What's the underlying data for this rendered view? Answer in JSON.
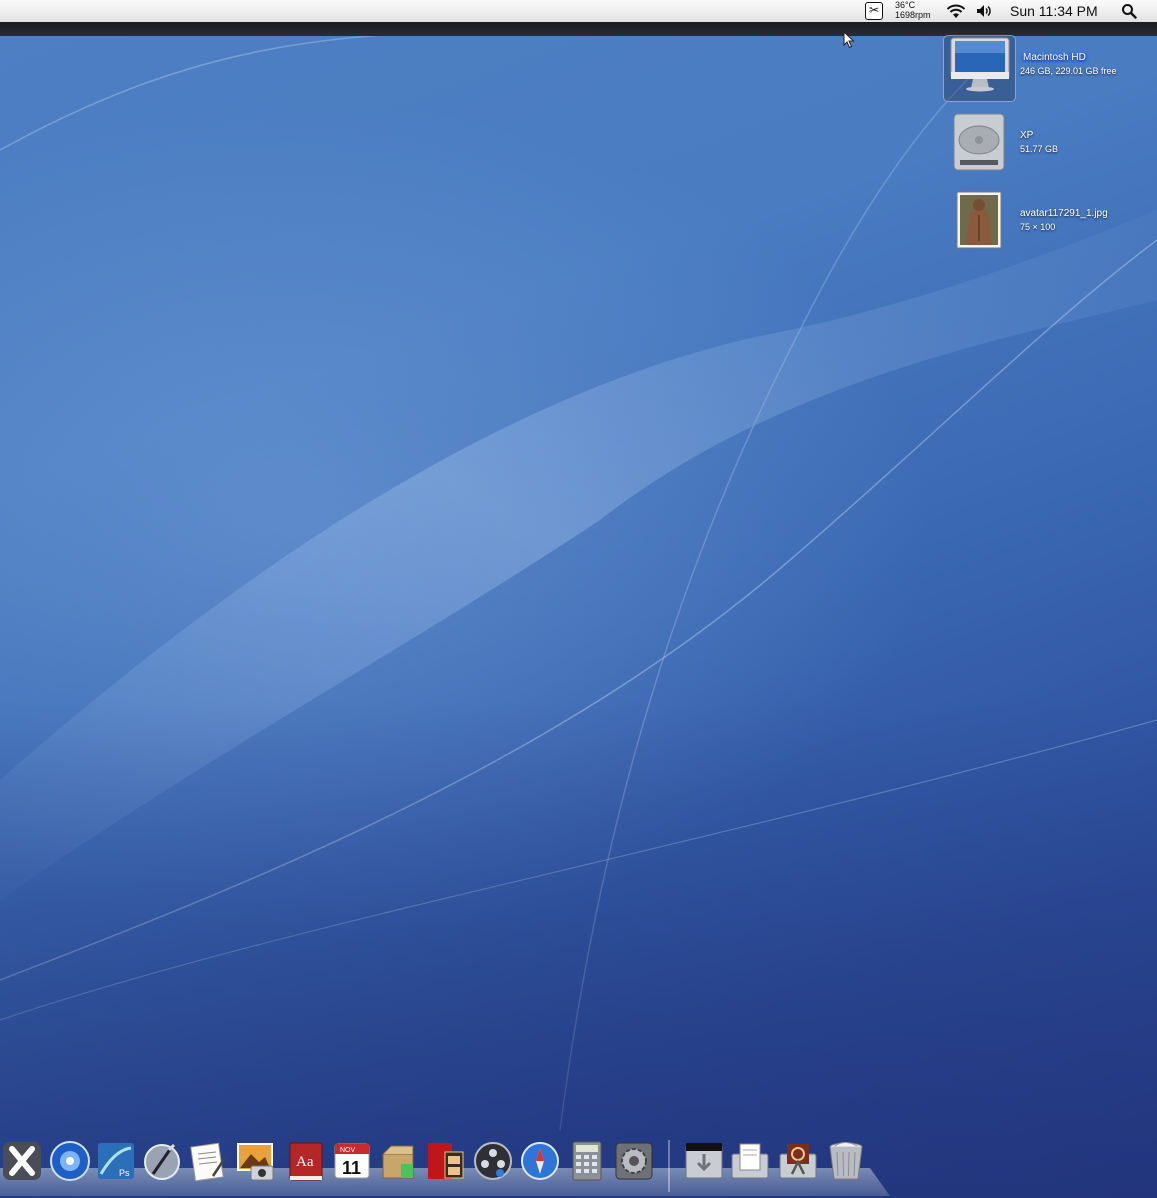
{
  "menubar": {
    "temperature": "36°C",
    "fan_speed": "1698rpm",
    "clock": "Sun 11:34 PM"
  },
  "desktop_icons": [
    {
      "name": "Macintosh HD",
      "sub": "246 GB, 229.01 GB free",
      "icon": "imac-icon",
      "selected": true
    },
    {
      "name": "XP",
      "sub": "51.77 GB",
      "icon": "hard-drive-icon",
      "selected": false
    },
    {
      "name": "avatar117291_1.jpg",
      "sub": "75 × 100",
      "icon": "image-file-icon",
      "selected": false
    }
  ],
  "dock": {
    "apps": [
      {
        "icon": "x-app-icon",
        "badge": ""
      },
      {
        "icon": "dvd-player-icon",
        "badge": ""
      },
      {
        "icon": "photoshop-icon",
        "badge": "Ps"
      },
      {
        "icon": "script-editor-icon",
        "badge": ""
      },
      {
        "icon": "textedit-icon",
        "badge": ""
      },
      {
        "icon": "iphoto-icon",
        "badge": ""
      },
      {
        "icon": "dictionary-icon",
        "badge": "Aa"
      },
      {
        "icon": "ical-icon",
        "badge": "11",
        "month": "NOV"
      },
      {
        "icon": "installer-icon",
        "badge": ""
      },
      {
        "icon": "movie-maker-icon",
        "badge": ""
      },
      {
        "icon": "front-row-icon",
        "badge": ""
      },
      {
        "icon": "safari-icon",
        "badge": ""
      },
      {
        "icon": "calculator-icon",
        "badge": ""
      },
      {
        "icon": "system-preferences-icon",
        "badge": ""
      }
    ],
    "stacks": [
      {
        "icon": "downloads-stack-icon"
      },
      {
        "icon": "documents-stack-icon"
      },
      {
        "icon": "applications-stack-icon"
      },
      {
        "icon": "trash-icon"
      }
    ]
  },
  "colors": {
    "desktop_top": "#4e7fc3",
    "desktop_bottom": "#283f8c",
    "selection": "#3b78d8"
  }
}
